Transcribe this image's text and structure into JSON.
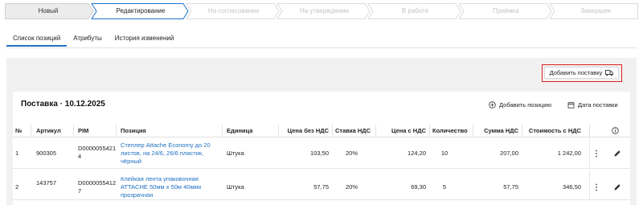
{
  "stepper": {
    "steps": [
      {
        "label": "Новый",
        "state": "done"
      },
      {
        "label": "Редактирование",
        "state": "current"
      },
      {
        "label": "На согласовании",
        "state": "pending"
      },
      {
        "label": "На утверждении",
        "state": "pending"
      },
      {
        "label": "В работе",
        "state": "pending"
      },
      {
        "label": "Приёмка",
        "state": "pending"
      },
      {
        "label": "Завершен",
        "state": "pending"
      }
    ],
    "colors": {
      "done_bg": "#ececec",
      "current_border": "#1e73c9",
      "pending_text": "#c4c4c4"
    }
  },
  "tabs": [
    {
      "label": "Список позиций",
      "active": true
    },
    {
      "label": "Атрибуты",
      "active": false
    },
    {
      "label": "История изменений",
      "active": false
    }
  ],
  "toolbar": {
    "add_supply_label": "Добавить поставку",
    "highlight_color": "#e02020"
  },
  "card": {
    "title": "Поставка · 10.12.2025",
    "add_position_label": "Добавить позицию",
    "supply_dates_label": "Дата поставки"
  },
  "table": {
    "headers": {
      "num": "№",
      "article": "Артикул",
      "pim": "PIM",
      "position": "Позиция",
      "unit": "Единица",
      "price_no_vat": "Цена без НДС",
      "vat_rate": "Ставка НДС",
      "price_vat": "Цена с НДС",
      "qty": "Количество",
      "sum_vat": "Сумма НДС",
      "cost_vat": "Стоимость с НДС"
    },
    "rows": [
      {
        "num": "1",
        "article": "900305",
        "pim_line1": "D0000055421",
        "pim_line2": "4",
        "pos_line1": "Степлер Attache Economy до 20",
        "pos_line2": "листов, на 24/6, 26/6 пластик,",
        "pos_line3": "чёрный",
        "unit": "Штука",
        "price_no_vat": "103,50",
        "vat_rate": "20%",
        "price_vat": "124,20",
        "qty": "10",
        "sum_vat": "207,00",
        "cost_vat": "1 242,00"
      },
      {
        "num": "2",
        "article": "143757",
        "pim_line1": "D0000055412",
        "pim_line2": "7",
        "pos_line1": "Клейкая лента упаковочная",
        "pos_line2": "ATTACHE 50мм х 50м 40мкм",
        "pos_line3": "прозрачная",
        "unit": "Штука",
        "price_no_vat": "57,75",
        "vat_rate": "20%",
        "price_vat": "69,30",
        "qty": "5",
        "sum_vat": "57,75",
        "cost_vat": "346,50"
      }
    ]
  },
  "icons": {
    "truck": "truck-icon",
    "plus_circle": "plus-circle-icon",
    "calendar": "calendar-icon",
    "info": "info-icon",
    "more": "more-vertical-icon",
    "edit": "pencil-icon"
  },
  "colors": {
    "accent": "#1e73c9",
    "link": "#1e6fc0",
    "panel_bg": "#f1f1f1"
  }
}
